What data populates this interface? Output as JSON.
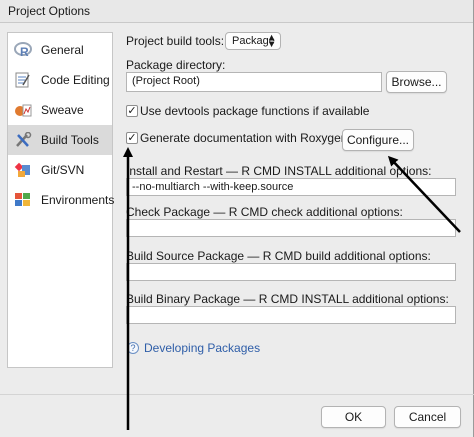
{
  "window": {
    "title": "Project Options"
  },
  "sidebar": {
    "items": [
      {
        "label": "General"
      },
      {
        "label": "Code Editing"
      },
      {
        "label": "Sweave"
      },
      {
        "label": "Build Tools",
        "selected": true
      },
      {
        "label": "Git/SVN"
      },
      {
        "label": "Environments"
      }
    ]
  },
  "build": {
    "tools_label": "Project build tools:",
    "tools_value": "Package",
    "package_dir_label": "Package directory:",
    "package_dir_value": "(Project Root)",
    "browse_label": "Browse...",
    "devtools_label": "Use devtools package functions if available",
    "devtools_checked": true,
    "roxygen_label": "Generate documentation with Roxygen",
    "roxygen_checked": true,
    "configure_label": "Configure...",
    "install_label": "Install and Restart — R CMD INSTALL additional options:",
    "install_value": "--no-multiarch --with-keep.source",
    "check_label": "Check Package — R CMD check additional options:",
    "check_value": "",
    "build_source_label": "Build Source Package — R CMD build additional options:",
    "build_source_value": "",
    "build_binary_label": "Build Binary Package — R CMD INSTALL additional options:",
    "build_binary_value": "",
    "help_link": "Developing Packages"
  },
  "footer": {
    "ok_label": "OK",
    "cancel_label": "Cancel"
  },
  "icons": {
    "general": "r-logo-icon",
    "code_editing": "code-editing-icon",
    "sweave": "sweave-icon",
    "build_tools": "build-tools-icon",
    "git": "git-svn-icon",
    "environments": "environments-icon",
    "help": "help-question-icon",
    "annotation": "annotation-arrow-icon"
  },
  "colors": {
    "selected_bg": "#dadada",
    "link": "#2f5ea8",
    "annotation_arrow": "#000000"
  }
}
